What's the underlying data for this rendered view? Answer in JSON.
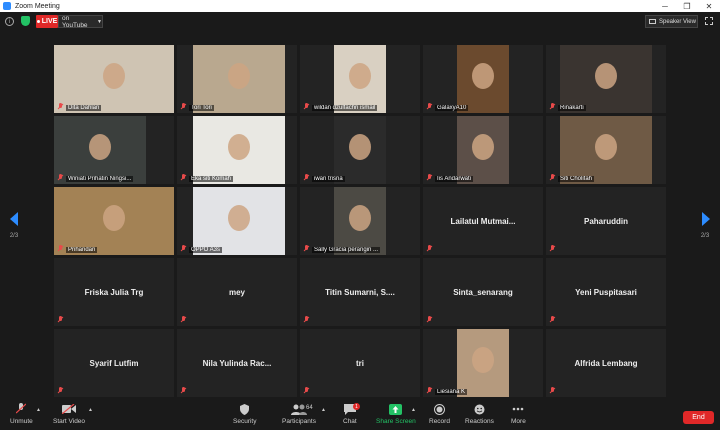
{
  "window": {
    "title": "Zoom Meeting",
    "controls": [
      "─",
      "❐",
      "✕"
    ]
  },
  "topbar": {
    "live_label": "LIVE",
    "live_target": "on YouTube",
    "view_label": "Speaker View"
  },
  "pagination": {
    "left": "2/3",
    "right": "2/3"
  },
  "tiles": [
    {
      "name": "Dita Dahlan",
      "bg": "#cfc4b3"
    },
    {
      "name": "Tori Tori",
      "bg": "#b9a88f"
    },
    {
      "name": "wildan dzulfachri ismail",
      "bg": "#d9d0c2"
    },
    {
      "name": "GalaxyA10",
      "bg": "#6b4a2e"
    },
    {
      "name": "Rinakarti",
      "bg": "#3a3430"
    },
    {
      "name": "Winiati Prihatin Ningsi...",
      "bg": "#3b3f3d"
    },
    {
      "name": "Eka siti Komah",
      "bg": "#e9e8e3"
    },
    {
      "name": "iwan trisna",
      "bg": "#2b2b2b"
    },
    {
      "name": "Iis Andarwati",
      "bg": "#5c4f48"
    },
    {
      "name": "Siti Cholifah",
      "bg": "#6f5a45"
    },
    {
      "name": "Prihandari",
      "bg": "#a38255"
    },
    {
      "name": "OPPO A3s",
      "bg": "#e2e3e6"
    },
    {
      "name": "Sally Gracia perangin ...",
      "bg": "#4c4a44"
    },
    {
      "name": "Lailatul Mutmai..."
    },
    {
      "name": "Paharuddin"
    },
    {
      "name": "Friska Julia Trg"
    },
    {
      "name": "mey"
    },
    {
      "name": "Titin Sumarni, S...."
    },
    {
      "name": "Sinta_senarang"
    },
    {
      "name": "Yeni Puspitasari"
    },
    {
      "name": "Syarif Lutfim"
    },
    {
      "name": "Nila Yulinda Rac..."
    },
    {
      "name": "tri"
    },
    {
      "name": "Liesiana K",
      "bg": "#b59a7e"
    },
    {
      "name": "Alfrida Lembang"
    }
  ],
  "toolbar": {
    "unmute": "Unmute",
    "start_video": "Start Video",
    "security": "Security",
    "participants": "Participants",
    "participants_count": "64",
    "chat": "Chat",
    "chat_badge": "1",
    "share_screen": "Share Screen",
    "record": "Record",
    "reactions": "Reactions",
    "more": "More",
    "end": "End"
  },
  "colors": {
    "accent": "#2d8cff",
    "live": "#e02828",
    "share": "#23c265"
  },
  "icons": [
    "info-icon",
    "shield-icon",
    "grid-icon",
    "fullscreen-icon",
    "mic-muted-icon",
    "video-off-icon",
    "security-shield-icon",
    "participants-icon",
    "chat-icon",
    "share-screen-icon",
    "record-icon",
    "reactions-icon",
    "more-icon"
  ]
}
